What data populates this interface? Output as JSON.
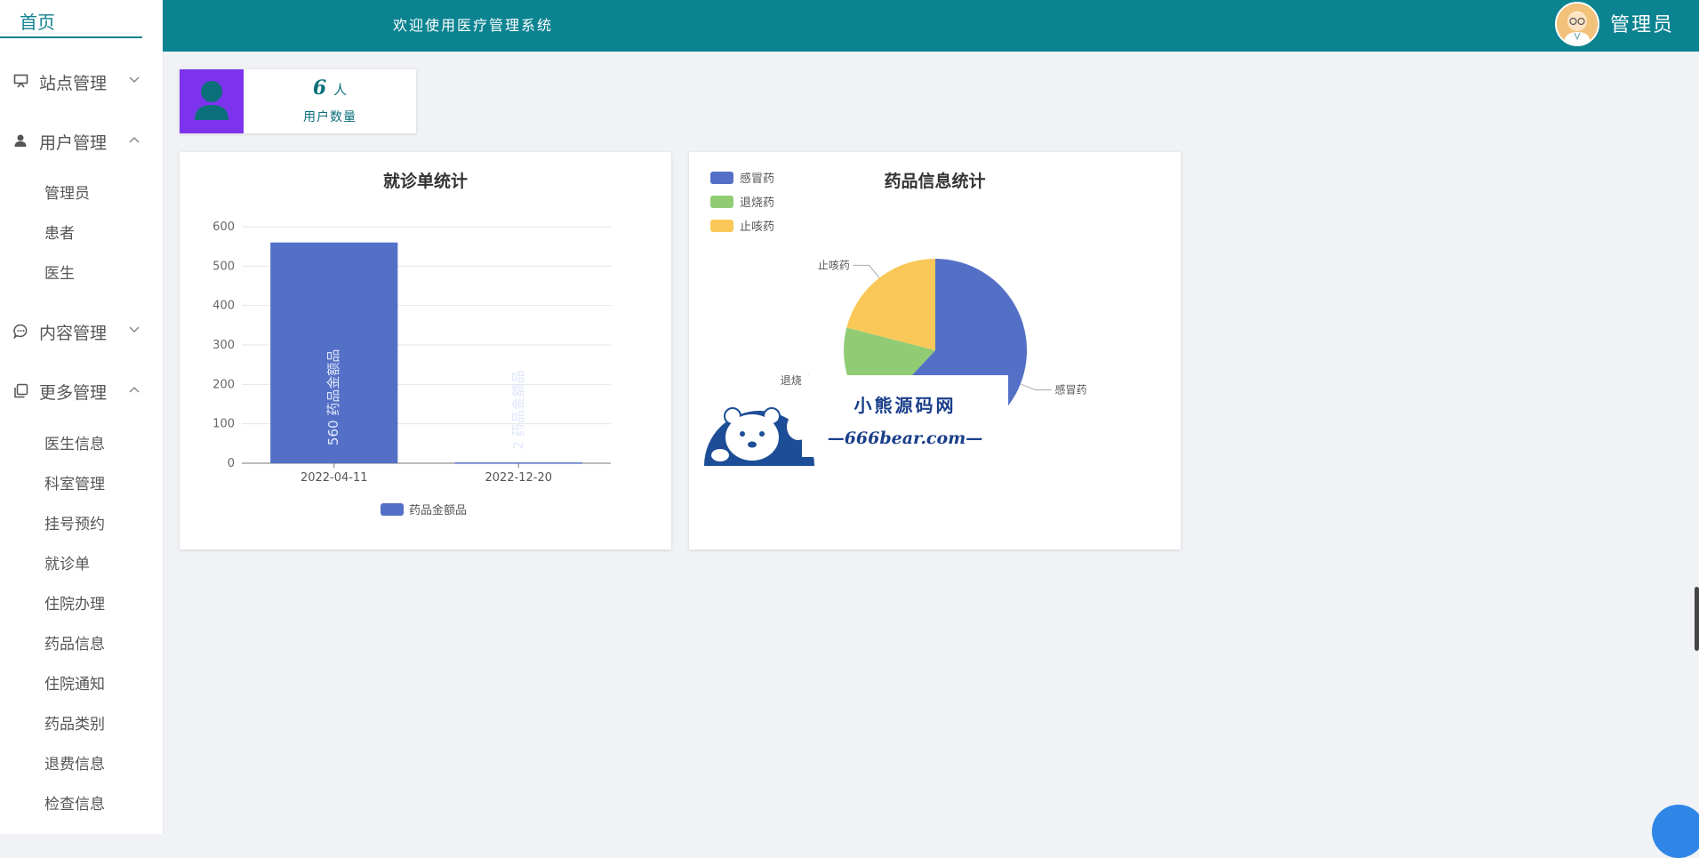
{
  "sidebar": {
    "home_tab": "首页",
    "groups": [
      {
        "label": "站点管理",
        "icon": "monitor-icon",
        "expanded": false,
        "items": []
      },
      {
        "label": "用户管理",
        "icon": "user-icon",
        "expanded": true,
        "items": [
          "管理员",
          "患者",
          "医生"
        ]
      },
      {
        "label": "内容管理",
        "icon": "chat-icon",
        "expanded": false,
        "items": []
      },
      {
        "label": "更多管理",
        "icon": "copy-icon",
        "expanded": true,
        "items": [
          "医生信息",
          "科室管理",
          "挂号预约",
          "就诊单",
          "住院办理",
          "药品信息",
          "住院通知",
          "药品类别",
          "退费信息",
          "检查信息"
        ]
      }
    ]
  },
  "header": {
    "title": "欢迎使用医疗管理系统",
    "username": "管理员"
  },
  "stat_card": {
    "value": "6",
    "unit": "人",
    "label": "用户数量",
    "icon": "user-silhouette-icon"
  },
  "chart_data": [
    {
      "type": "bar",
      "title": "就诊单统计",
      "categories": [
        "2022-04-11",
        "2022-12-20"
      ],
      "series": [
        {
          "name": "药品金额品",
          "values": [
            560,
            2
          ]
        }
      ],
      "ylim": [
        0,
        600
      ],
      "yticks": [
        0,
        100,
        200,
        300,
        400,
        500,
        600
      ],
      "bar_labels": [
        "560  药品金额品",
        "2  药品金额品"
      ],
      "grid": true,
      "legend_position": "bottom",
      "color": "#5470c6"
    },
    {
      "type": "pie",
      "title": "药品信息统计",
      "slices": [
        {
          "name": "感冒药",
          "value": 62,
          "color": "#5470c6"
        },
        {
          "name": "退烧药",
          "value": 17,
          "color": "#91cc75"
        },
        {
          "name": "止咳药",
          "value": 21,
          "color": "#fac858"
        }
      ],
      "legend_position": "top-left"
    }
  ],
  "watermark": {
    "name": "小熊源码网",
    "url": "—666bear.com—"
  }
}
